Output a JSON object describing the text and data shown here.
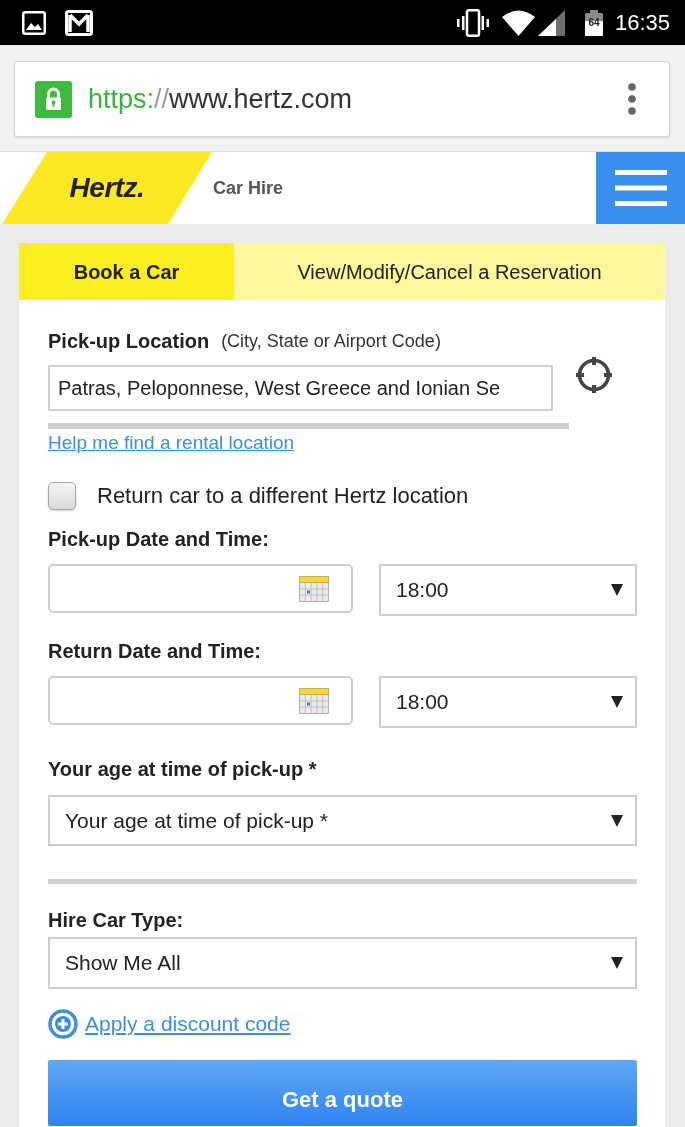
{
  "status_bar": {
    "battery": "64",
    "time": "16:35"
  },
  "browser": {
    "url": {
      "scheme": "https:",
      "separator": "//",
      "host": "www.hertz.com"
    }
  },
  "header": {
    "logo": "Hertz.",
    "title": "Car Hire"
  },
  "tabs": [
    {
      "label": "Book a Car",
      "selected": true
    },
    {
      "label": "View/Modify/Cancel a Reservation",
      "selected": false
    }
  ],
  "form": {
    "pickup_location": {
      "label": "Pick-up Location",
      "note": "(City, State or Airport Code)",
      "value": "Patras, Peloponnese, West Greece and Ionian Se"
    },
    "help_link": "Help me find a rental location",
    "return_different": {
      "label": "Return car to a different Hertz location",
      "checked": false
    },
    "pickup_datetime": {
      "label": "Pick-up Date and Time:",
      "time": "18:00"
    },
    "return_datetime": {
      "label": "Return Date and Time:",
      "time": "18:00"
    },
    "age": {
      "label": "Your age at time of pick-up *",
      "value": "Your age at time of pick-up *"
    },
    "car_type": {
      "label": "Hire Car Type:",
      "value": "Show Me All"
    },
    "discount_link": "Apply a discount code",
    "submit": "Get a quote"
  }
}
